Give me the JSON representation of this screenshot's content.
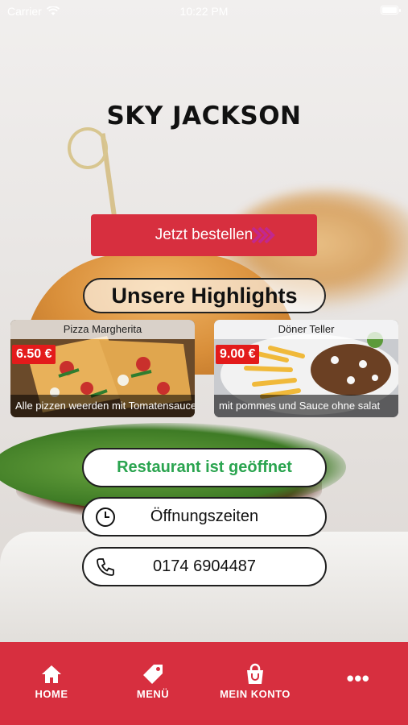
{
  "status_bar": {
    "carrier": "Carrier",
    "time": "10:22 PM"
  },
  "restaurant": {
    "name": "SKY JACKSON"
  },
  "order_button": {
    "label": "Jetzt bestellen"
  },
  "highlights": {
    "title": "Unsere Highlights",
    "items": [
      {
        "name": "Pizza Margherita",
        "price": "6.50 €",
        "description": "Alle pizzen weerden mit Tomatensauce,..."
      },
      {
        "name": "Döner Teller",
        "price": "9.00 €",
        "description": "mit pommes und Sauce ohne salat"
      }
    ]
  },
  "status_pill": {
    "label": "Restaurant ist geöffnet"
  },
  "hours_pill": {
    "label": "Öffnungszeiten"
  },
  "phone_pill": {
    "label": "0174 6904487"
  },
  "tab_bar": {
    "items": [
      {
        "label": "HOME",
        "icon": "home-icon"
      },
      {
        "label": "MENÜ",
        "icon": "tag-icon"
      },
      {
        "label": "MEIN KONTO",
        "icon": "bag-icon"
      },
      {
        "label": "•••",
        "icon": "more-icon"
      }
    ]
  },
  "colors": {
    "accent": "#d72f3f",
    "open_green": "#2aa44f",
    "price_red": "#e31b1b",
    "arrow_pink": "#c2288e"
  }
}
